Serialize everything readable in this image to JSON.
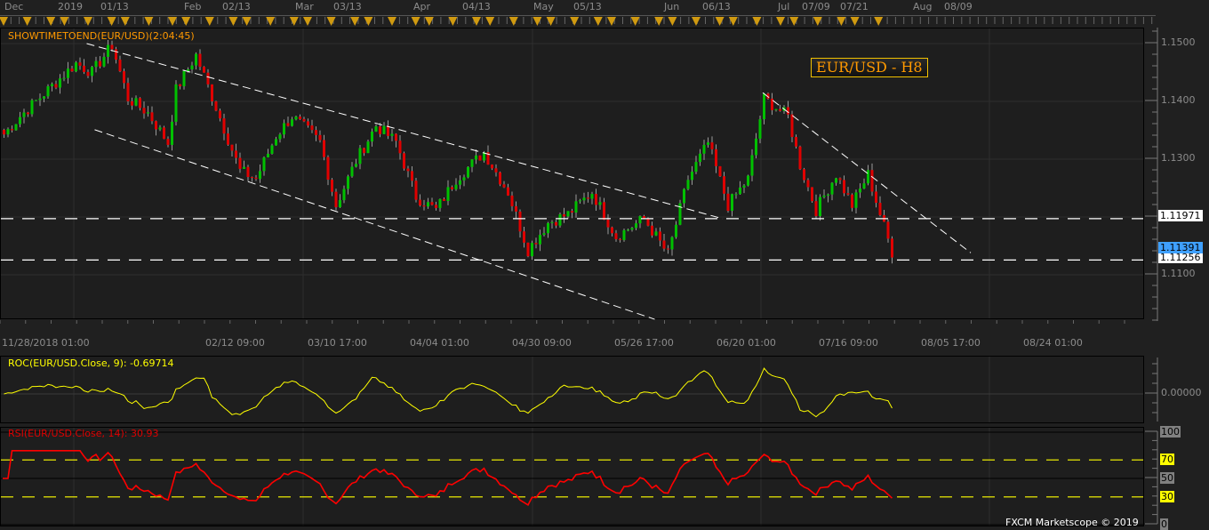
{
  "top_axis": {
    "labels": [
      "Dec",
      "2019",
      "01/13",
      "Feb",
      "02/13",
      "Mar",
      "03/13",
      "Apr",
      "04/13",
      "May",
      "05/13",
      "Jun",
      "06/13",
      "Jul",
      "07/09",
      "07/21",
      "Aug",
      "08/09"
    ]
  },
  "chart_data": [
    {
      "type": "candlestick",
      "title": "EUR/USD - H8",
      "indicator_label": "SHOWTIMETOEND(EUR/USD)(2:04:45)",
      "ylim": [
        1.1005,
        1.1525
      ],
      "y_ticks": [
        "1.1500",
        "1.1400",
        "1.1300",
        "1.1100"
      ],
      "x_tick_labels": [
        "11/28/2018 01:00",
        "02/12 09:00",
        "03/10 17:00",
        "04/04 01:00",
        "04/30 09:00",
        "05/26 17:00",
        "06/20 01:00",
        "07/16 09:00",
        "08/05 17:00",
        "08/24 01:00"
      ],
      "keypoints": {
        "bar": [
          0,
          4,
          11,
          18,
          22,
          27,
          31,
          36,
          41,
          43,
          48,
          53,
          59,
          63,
          68,
          72,
          79,
          83,
          88,
          93,
          98,
          103,
          108,
          113,
          120,
          126,
          131,
          136,
          141,
          147,
          153,
          160,
          166,
          171,
          176,
          181,
          186,
          190,
          196,
          199,
          203,
          208,
          212,
          216,
          219,
          222
        ],
        "close": [
          1.1343,
          1.1374,
          1.142,
          1.1466,
          1.145,
          1.1497,
          1.1405,
          1.138,
          1.1328,
          1.142,
          1.148,
          1.139,
          1.128,
          1.1266,
          1.134,
          1.1374,
          1.133,
          1.122,
          1.1297,
          1.1358,
          1.133,
          1.1235,
          1.1212,
          1.1266,
          1.1312,
          1.1243,
          1.1143,
          1.119,
          1.1205,
          1.1243,
          1.1166,
          1.1197,
          1.1135,
          1.1266,
          1.1328,
          1.122,
          1.1266,
          1.1405,
          1.1374,
          1.129,
          1.1212,
          1.1274,
          1.122,
          1.1274,
          1.1205,
          1.1139
        ]
      },
      "levels": [
        {
          "value": 1.11971,
          "label": "1.11971"
        },
        {
          "value": 1.11256,
          "label": "1.11256"
        }
      ],
      "current_price": {
        "value": 1.11391,
        "label": "1.11391"
      },
      "trendlines": [
        {
          "from": [
            21,
            1.15
          ],
          "to": [
            180,
            1.1197
          ]
        },
        {
          "from": [
            23,
            1.1351
          ],
          "to": [
            163,
            1.1023
          ]
        },
        {
          "from": [
            190,
            1.1415
          ],
          "to": [
            242,
            1.1138
          ]
        }
      ],
      "colors": {
        "up": "#00c000",
        "down": "#e00000",
        "title": "#ff9900",
        "level": "#ffffff",
        "trend": "#ffffff"
      }
    },
    {
      "type": "line",
      "title": "ROC(EUR/USD.Close, 9): -0.69714",
      "period": 9,
      "y_ticks": [
        "0.00000"
      ],
      "color": "#ffff00"
    },
    {
      "type": "line",
      "title": "RSI(EUR/USD.Close, 14): 30.93",
      "period": 14,
      "ylim": [
        0,
        100
      ],
      "y_ticks": [
        "100",
        "70",
        "50",
        "30",
        "0"
      ],
      "levels": [
        70,
        30
      ],
      "color": "#ff0000"
    }
  ],
  "footer": {
    "copyright": "FXCM Marketscope © 2019"
  }
}
